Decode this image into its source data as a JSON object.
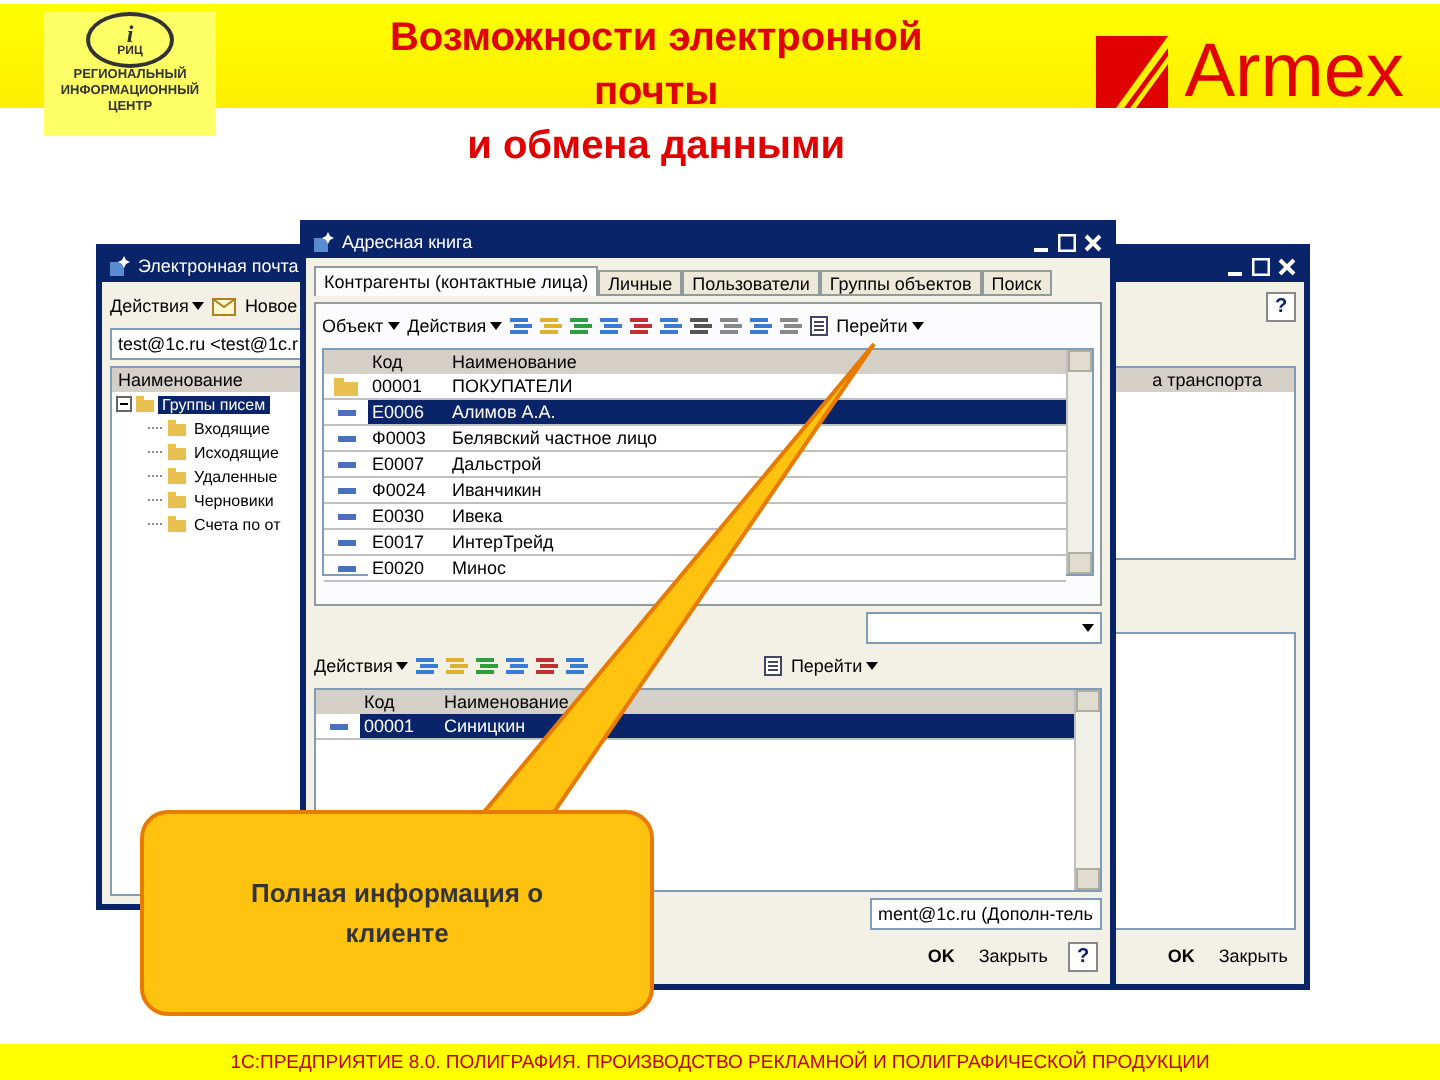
{
  "header": {
    "logo": {
      "letter": "i",
      "abbr": "РИЦ",
      "lines": [
        "РЕГИОНАЛЬНЫЙ",
        "ИНФОРМАЦИОННЫЙ",
        "ЦЕНТР"
      ]
    },
    "title_lines": [
      "Возможности электронной",
      "почты",
      "и обмена данными"
    ],
    "brand": "Armex"
  },
  "mail_window": {
    "title": "Электронная почта",
    "actions": "Действия",
    "new_item": "Новое",
    "account": "test@1c.ru <test@1c.r",
    "column": "Наименование",
    "tree": [
      {
        "label": "Группы писем",
        "selected": true,
        "expanded": true,
        "children": [
          {
            "label": "Входящие",
            "selected": false
          },
          {
            "label": "Исходящие",
            "selected": false
          },
          {
            "label": "Удаленные",
            "selected": false
          },
          {
            "label": "Черновики",
            "selected": false
          },
          {
            "label": "Счета по от",
            "selected": false
          }
        ]
      }
    ]
  },
  "back_window": {
    "column": "а транспорта",
    "buttons": [
      "OK",
      "Закрыть"
    ],
    "help": "?"
  },
  "address_window": {
    "title": "Адресная книга",
    "tabs": [
      {
        "label": "Контрагенты (контактные лица)",
        "selected": true
      },
      {
        "label": "Личные",
        "selected": false
      },
      {
        "label": "Пользователи",
        "selected": false
      },
      {
        "label": "Группы объектов",
        "selected": false
      },
      {
        "label": "Поиск",
        "selected": false
      }
    ],
    "toolbar": {
      "object": "Объект",
      "actions": "Действия",
      "goto": "Перейти"
    },
    "columns": [
      "Код",
      "Наименование"
    ],
    "rows": [
      {
        "kind": "folder",
        "code": "00001",
        "name": "ПОКУПАТЕЛИ",
        "selected": false
      },
      {
        "kind": "item",
        "code": "Е0006",
        "name": "Алимов А.А.",
        "selected": true
      },
      {
        "kind": "item",
        "code": "Ф0003",
        "name": "Белявский частное лицо",
        "selected": false
      },
      {
        "kind": "item",
        "code": "Е0007",
        "name": "Дальстрой",
        "selected": false
      },
      {
        "kind": "item",
        "code": "Ф0024",
        "name": "Иванчикин",
        "selected": false
      },
      {
        "kind": "item",
        "code": "Е0030",
        "name": "Ивека",
        "selected": false
      },
      {
        "kind": "item",
        "code": "Е0017",
        "name": "ИнтерТрейд",
        "selected": false
      },
      {
        "kind": "item",
        "code": "Е0020",
        "name": "Минос",
        "selected": false
      }
    ],
    "contacts_toolbar": {
      "actions": "Действия",
      "goto": "Перейти"
    },
    "contacts_columns": [
      "Код",
      "Наименование"
    ],
    "contacts": [
      {
        "code": "00001",
        "name": "Синицкин",
        "selected": true
      }
    ],
    "email": "ment@1c.ru (Дополн-тель",
    "buttons": [
      "OK",
      "Закрыть"
    ],
    "help": "?"
  },
  "callout": {
    "text": "Полная информация о клиенте"
  },
  "footer": "1С:ПРЕДПРИЯТИЕ 8.0. ПОЛИГРАФИЯ. ПРОИЗВОДСТВО РЕКЛАМНОЙ И ПОЛИГРАФИЧЕСКОЙ ПРОДУКЦИИ"
}
